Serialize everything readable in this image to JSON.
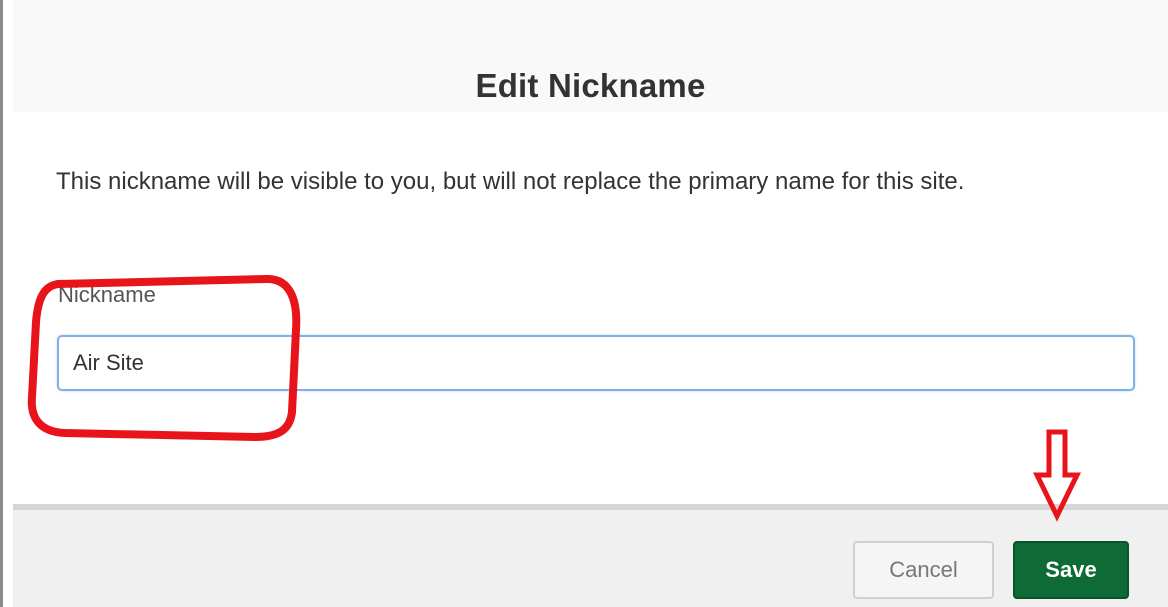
{
  "dialog": {
    "title": "Edit Nickname",
    "description": "This nickname will be visible to you, but will not replace the primary name for this site.",
    "field_label": "Nickname",
    "nickname_value": "Air Site",
    "cancel_label": "Cancel",
    "save_label": "Save"
  },
  "colors": {
    "save_button": "#0e6b35",
    "annotation": "#e8141b",
    "input_focus_border": "#7fb1e6"
  },
  "icons": {
    "annotation_highlight": "highlight-circle-icon",
    "annotation_arrow": "arrow-down-icon"
  }
}
